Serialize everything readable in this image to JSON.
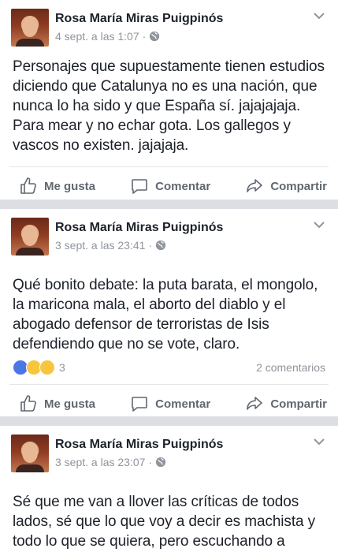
{
  "posts": [
    {
      "author": "Rosa María Miras Puigpinós",
      "date": "4 sept. a las 1:07",
      "text": "Personajes que supuestamente tienen estudios diciendo que Catalunya no es una nación, que nunca lo ha sido y que España sí. jajajajaja. Para mear y no echar gota. Los gallegos y vascos no existen. jajajaja.",
      "reactions_count": "",
      "comments": "",
      "actions": {
        "like": "Me gusta",
        "comment": "Comentar",
        "share": "Compartir"
      }
    },
    {
      "author": "Rosa María Miras Puigpinós",
      "date": "3 sept. a las 23:41",
      "text": "Qué bonito debate: la puta barata, el mongolo, la maricona mala, el aborto del diablo y el abogado defensor de terroristas de Isis defendiendo que no se vote, claro.",
      "reactions_count": "3",
      "comments": "2 comentarios",
      "actions": {
        "like": "Me gusta",
        "comment": "Comentar",
        "share": "Compartir"
      }
    },
    {
      "author": "Rosa María Miras Puigpinós",
      "date": "3 sept. a las 23:07",
      "text": "Sé que me van a llover las críticas de todos lados, sé que lo que voy a decir es machista y todo lo que se quiera, pero escuchando a"
    }
  ],
  "separator": "·",
  "colors": {
    "background": "#dcdee3",
    "meta": "#90949c",
    "action": "#606770"
  }
}
